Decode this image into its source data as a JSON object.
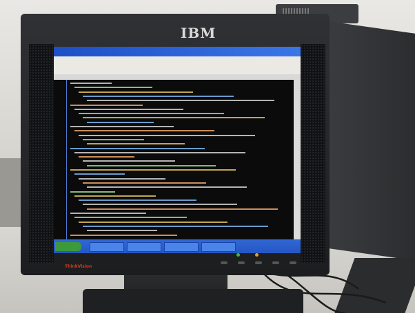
{
  "monitor": {
    "brand": "IBM",
    "model_logo": "ThinkVision"
  },
  "colors": {
    "bezel": "#1c1d1f",
    "titlebar": "#1d4fc6",
    "editor_bg": "#0b0b0b",
    "taskbar": "#2456c4",
    "led_green": "#38c038",
    "led_orange": "#e6a020"
  },
  "icons": [
    "speaker-grille-icon",
    "power-button-icon"
  ]
}
